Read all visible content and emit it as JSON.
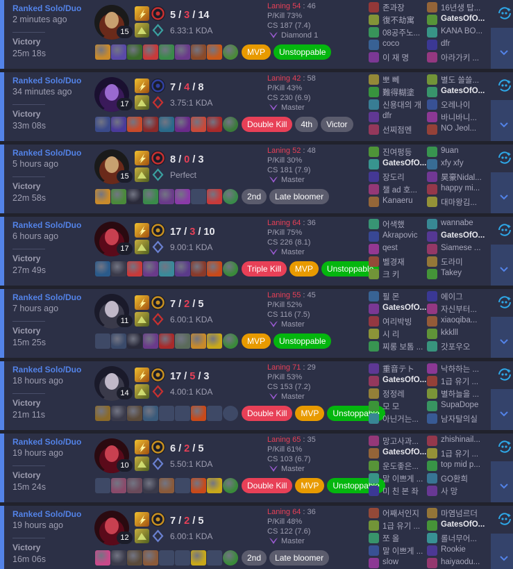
{
  "colors": {
    "background": "#21222c",
    "card": "#2c3046",
    "accent": "#5383e8",
    "loss_red": "#e84057",
    "mvp": "#e89a00",
    "unstoppable": "#04b60e",
    "grey_badge": "#5b5c6d",
    "side_button": "#34436b"
  },
  "icons": {
    "expand": "chevron-down-icon",
    "ai": "robot-face-icon",
    "rank": "rank-emblem-icon"
  },
  "matches": [
    {
      "queue": "Ranked Solo/Duo",
      "ago": "2 minutes ago",
      "result": "Victory",
      "duration": "25m 18s",
      "champion": "champion-portrait",
      "level": "15",
      "kda": {
        "k": "5",
        "d": "3",
        "a": "14"
      },
      "kda_ratio": "6.33:1 KDA",
      "laning_label": "Laning",
      "laning": "54",
      "laning_opp": "46",
      "pkill": "P/Kill 73%",
      "cs": "CS 187 (7.4)",
      "tier": "Diamond 1",
      "badges": [
        {
          "label": "MVP",
          "type": "mvp"
        },
        {
          "label": "Unstoppable",
          "type": "unst"
        }
      ],
      "items": [
        "#c88a2c",
        "#5a4aa8",
        "#3a6a2a",
        "#c83a3a",
        "#3a8a4a",
        "#6a3a8a",
        "#8a4a2a",
        "#c85a1a",
        "#4a8a3a"
      ],
      "team1": [
        "존과장",
        "復不劫寓",
        "08공주노...",
        "coco",
        "이 재 명"
      ],
      "team2": [
        "16년생 탑...",
        "GatesOfO...",
        "KANA BO...",
        "dfr",
        "아라가키 ..."
      ]
    },
    {
      "queue": "Ranked Solo/Duo",
      "ago": "34 minutes ago",
      "result": "Victory",
      "duration": "33m 08s",
      "champion": "champion-portrait",
      "level": "17",
      "kda": {
        "k": "7",
        "d": "4",
        "a": "8"
      },
      "kda_ratio": "3.75:1 KDA",
      "laning_label": "Laning",
      "laning": "42",
      "laning_opp": "58",
      "pkill": "P/Kill 43%",
      "cs": "CS 230 (6.9)",
      "tier": "Master",
      "badges": [
        {
          "label": "Double Kill",
          "type": "multi"
        },
        {
          "label": "4th",
          "type": "grey"
        },
        {
          "label": "Victor",
          "type": "grey"
        }
      ],
      "items": [
        "#3a4a8a",
        "#4a3a9a",
        "#c84a2a",
        "#8a2a2a",
        "#2a6a8a",
        "#6a2a8a",
        "#c84a3a",
        "#a82a2a",
        "#3a7a3a"
      ],
      "team1": [
        "뽀 뻬",
        "難得糊塗",
        "신용대의 개",
        "dfr",
        "선찌점멘"
      ],
      "team2": [
        "별도 쓸쓸...",
        "GatesOfO...",
        "오레나이",
        "바니바니...",
        "NO Jeol..."
      ]
    },
    {
      "queue": "Ranked Solo/Duo",
      "ago": "5 hours ago",
      "result": "Victory",
      "duration": "22m 58s",
      "champion": "champion-portrait",
      "level": "15",
      "kda": {
        "k": "8",
        "d": "0",
        "a": "3"
      },
      "kda_ratio": "Perfect",
      "laning_label": "Laning",
      "laning": "52",
      "laning_opp": "48",
      "pkill": "P/Kill 30%",
      "cs": "CS 181 (7.9)",
      "tier": "Master",
      "badges": [
        {
          "label": "2nd",
          "type": "grey"
        },
        {
          "label": "Late bloomer",
          "type": "grey"
        }
      ],
      "items": [
        "#c88a2c",
        "#4a8a3a",
        "#2a2a3a",
        "#3a8a4a",
        "#6a3a8a",
        "#8a3aa8",
        "",
        "#c83a3a",
        "#3a8a4a"
      ],
      "team1": [
        "진여펑등",
        "GatesOfO...",
        "장도리",
        "챌 ad 호...",
        "Kanaeru"
      ],
      "team2": [
        "9uan",
        "xfy xfy",
        "昊豪Nidal...",
        "happy mi...",
        "대마왕김..."
      ]
    },
    {
      "queue": "Ranked Solo/Duo",
      "ago": "6 hours ago",
      "result": "Victory",
      "duration": "27m 49s",
      "champion": "champion-portrait",
      "level": "17",
      "kda": {
        "k": "17",
        "d": "3",
        "a": "10"
      },
      "kda_ratio": "9.00:1 KDA",
      "laning_label": "Laning",
      "laning": "64",
      "laning_opp": "36",
      "pkill": "P/Kill 75%",
      "cs": "CS 226 (8.1)",
      "tier": "Master",
      "badges": [
        {
          "label": "Triple Kill",
          "type": "multi"
        },
        {
          "label": "MVP",
          "type": "mvp"
        },
        {
          "label": "Unstoppable",
          "type": "unst"
        }
      ],
      "items": [
        "#2a5a8a",
        "#3a3a4a",
        "#c83a3a",
        "#6a3a8a",
        "#3a8a9a",
        "#5a3a8a",
        "#8a3a2a",
        "#c84a1a",
        "#3a8a3a"
      ],
      "team1": [
        "어색했",
        "Akrapovic",
        "qest",
        "벨경재",
        "크 키"
      ],
      "team2": [
        "wannabe",
        "GatesOfO...",
        "Siamese ...",
        "도라미",
        "Takey"
      ]
    },
    {
      "queue": "Ranked Solo/Duo",
      "ago": "7 hours ago",
      "result": "Victory",
      "duration": "15m 25s",
      "champion": "champion-portrait",
      "level": "11",
      "kda": {
        "k": "7",
        "d": "2",
        "a": "5"
      },
      "kda_ratio": "6.00:1 KDA",
      "laning_label": "Laning",
      "laning": "55",
      "laning_opp": "45",
      "pkill": "P/Kill 52%",
      "cs": "CS 116 (7.5)",
      "tier": "Master",
      "badges": [
        {
          "label": "MVP",
          "type": "mvp"
        },
        {
          "label": "Unstoppable",
          "type": "unst"
        }
      ],
      "items": [
        "",
        "#3a4a6a",
        "#2a2a3a",
        "#6a3a8a",
        "#a82a2a",
        "#5a6a5a",
        "#c88a2a",
        "#c8a81a",
        "#3a8a3a"
      ],
      "team1": [
        "필 몬",
        "GatesOfO...",
        "여리박빙",
        "시 리",
        "찌롱 보톰 ..."
      ],
      "team2": [
        "에이그",
        "자신부터...",
        "xiaoqiba...",
        "kkklll",
        "갓포우오"
      ]
    },
    {
      "queue": "Ranked Solo/Duo",
      "ago": "18 hours ago",
      "result": "Victory",
      "duration": "21m 11s",
      "champion": "champion-portrait",
      "level": "14",
      "kda": {
        "k": "17",
        "d": "5",
        "a": "3"
      },
      "kda_ratio": "4.00:1 KDA",
      "laning_label": "Laning",
      "laning": "71",
      "laning_opp": "29",
      "pkill": "P/Kill 53%",
      "cs": "CS 153 (7.2)",
      "tier": "Master",
      "badges": [
        {
          "label": "Double Kill",
          "type": "multi"
        },
        {
          "label": "MVP",
          "type": "mvp"
        },
        {
          "label": "Unstoppable",
          "type": "unst"
        }
      ],
      "items": [
        "#8a6a2a",
        "#3a3a4a",
        "#5a4a3a",
        "#3a5a7a",
        "",
        "",
        "#c84a1a",
        "",
        ""
      ],
      "team1": [
        "重音テト",
        "GatesOfO...",
        "정정레",
        "모 모",
        "아닌거는..."
      ],
      "team2": [
        "낙하하는 ...",
        "1급 유기 ...",
        "별하늘을 ...",
        "SupaDope",
        "남자탈의실"
      ]
    },
    {
      "queue": "Ranked Solo/Duo",
      "ago": "19 hours ago",
      "result": "Victory",
      "duration": "15m 24s",
      "champion": "champion-portrait",
      "level": "10",
      "kda": {
        "k": "6",
        "d": "2",
        "a": "5"
      },
      "kda_ratio": "5.50:1 KDA",
      "laning_label": "Laning",
      "laning": "65",
      "laning_opp": "35",
      "pkill": "P/Kill 61%",
      "cs": "CS 103 (6.7)",
      "tier": "Master",
      "badges": [
        {
          "label": "Double Kill",
          "type": "multi"
        },
        {
          "label": "MVP",
          "type": "mvp"
        },
        {
          "label": "Unstoppable",
          "type": "unst"
        }
      ],
      "items": [
        "",
        "#8a4a6a",
        "#6a4a5a",
        "#3a3a4a",
        "#8a5a3a",
        "",
        "#c84a1a",
        "#c8a81a",
        "#3a8a3a"
      ],
      "team1": [
        "망고사과...",
        "GatesOfO...",
        "운도좋은...",
        "말 이쁘게 ...",
        "미 친 본 좌"
      ],
      "team2": [
        "zhishinail...",
        "1급 유기 ...",
        "top mid p...",
        "GO환희",
        "사 망"
      ]
    },
    {
      "queue": "Ranked Solo/Duo",
      "ago": "19 hours ago",
      "result": "Victory",
      "duration": "16m 06s",
      "champion": "champion-portrait",
      "level": "12",
      "kda": {
        "k": "7",
        "d": "2",
        "a": "5"
      },
      "kda_ratio": "6.00:1 KDA",
      "laning_label": "Laning",
      "laning": "64",
      "laning_opp": "36",
      "pkill": "P/Kill 48%",
      "cs": "CS 122 (7.6)",
      "tier": "Master",
      "badges": [
        {
          "label": "2nd",
          "type": "grey"
        },
        {
          "label": "Late bloomer",
          "type": "grey"
        }
      ],
      "items": [
        "#c84a8a",
        "#3a3a4a",
        "#5a4a3a",
        "#8a5a3a",
        "",
        "",
        "#c8a81a",
        "",
        "#3a8a3a"
      ],
      "team1": [
        "어째서인지",
        "1급 유기 ...",
        "쪼 올",
        "말 이쁘게 ...",
        "slow"
      ],
      "team2": [
        "마염넘르더",
        "GatesOfO...",
        "롤너무어...",
        "Rookie",
        "haiyaodu..."
      ]
    }
  ]
}
